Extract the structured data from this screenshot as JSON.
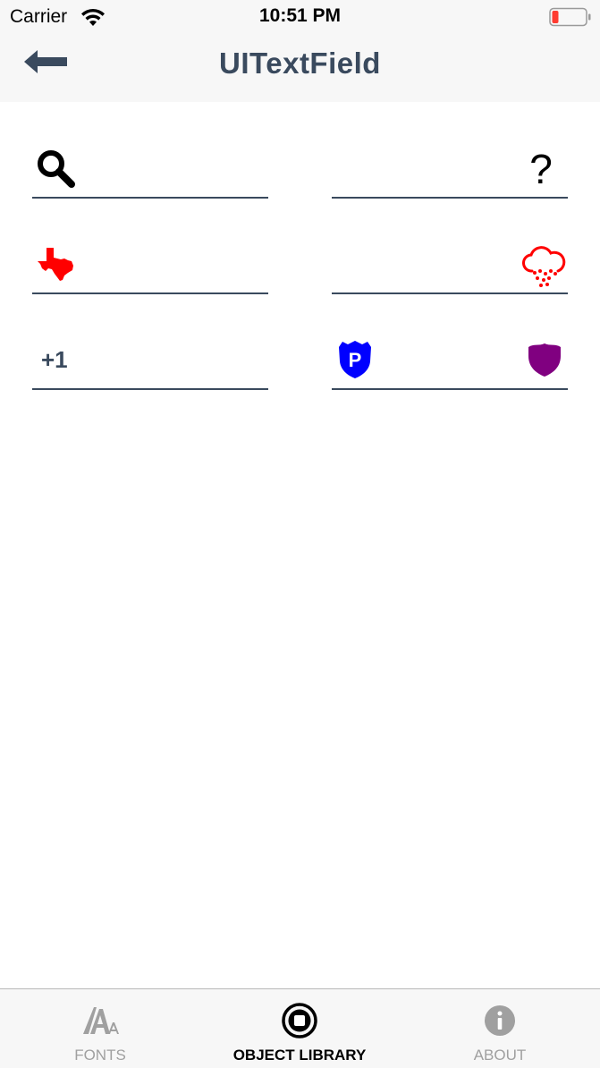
{
  "status_bar": {
    "carrier": "Carrier",
    "time": "10:51 PM",
    "wifi_icon": "wifi-icon",
    "battery_icon": "battery-low-icon",
    "battery_level": 0.2,
    "battery_color": "#ff3b30"
  },
  "nav": {
    "title": "UITextField",
    "back_icon": "arrow-left-icon",
    "title_color": "#3a4a5e"
  },
  "fields": [
    {
      "left_icon": "search-icon",
      "value": "",
      "placeholder": ""
    },
    {
      "right_icon": "question-mark-icon",
      "right_text": "?",
      "value": "",
      "placeholder": ""
    },
    {
      "left_icon": "texas-state-icon",
      "left_icon_color": "#ff0000",
      "value": "",
      "placeholder": ""
    },
    {
      "right_icon": "cloud-hail-icon",
      "right_icon_color": "#ff0000",
      "value": "",
      "placeholder": ""
    },
    {
      "left_text": "+1",
      "value": "",
      "placeholder": ""
    },
    {
      "left_icon": "police-badge-p-icon",
      "left_icon_color": "#0000ff",
      "right_icon": "shield-icon",
      "right_icon_color": "#800080",
      "value": "",
      "placeholder": ""
    }
  ],
  "tab_bar": {
    "tabs": [
      {
        "label": "FONTS",
        "icon": "fonts-icon",
        "active": false
      },
      {
        "label": "OBJECT LIBRARY",
        "icon": "object-library-icon",
        "active": true
      },
      {
        "label": "ABOUT",
        "icon": "info-icon",
        "active": false
      }
    ]
  }
}
